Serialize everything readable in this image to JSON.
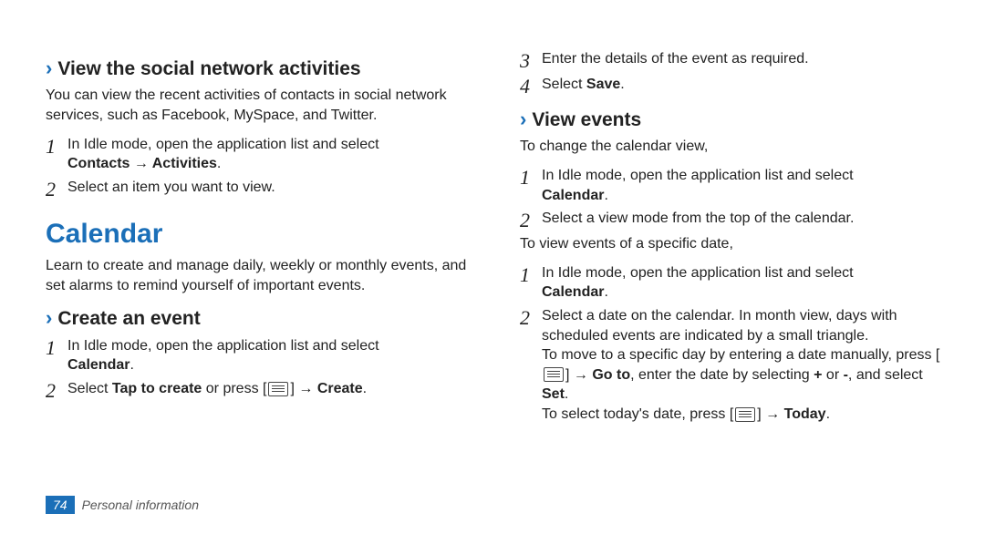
{
  "left": {
    "sub1_title": "View the social network activities",
    "sub1_para": "You can view the recent activities of contacts in social network services, such as Facebook, MySpace, and Twitter.",
    "sub1_step1_a": "In Idle mode, open the application list and select ",
    "sub1_step1_b": "Contacts → Activities",
    "sub1_step1_c": ".",
    "sub1_step2": "Select an item you want to view.",
    "section_title": "Calendar",
    "section_para": "Learn to create and manage daily, weekly or monthly events, and set alarms to remind yourself of important events.",
    "sub2_title": "Create an event",
    "sub2_step1_a": "In Idle mode, open the application list and select ",
    "sub2_step1_b": "Calendar",
    "sub2_step1_c": ".",
    "sub2_step2_a": "Select ",
    "sub2_step2_b": "Tap to create",
    "sub2_step2_c": " or press [",
    "sub2_step2_d": "] → ",
    "sub2_step2_e": "Create",
    "sub2_step2_f": "."
  },
  "right": {
    "step3": "Enter the details of the event as required.",
    "step4_a": "Select ",
    "step4_b": "Save",
    "step4_c": ".",
    "sub3_title": "View events",
    "sub3_para": "To change the calendar view,",
    "sub3_step1_a": "In Idle mode, open the application list and select ",
    "sub3_step1_b": "Calendar",
    "sub3_step1_c": ".",
    "sub3_step2": "Select a view mode from the top of the calendar.",
    "sub3_para2": "To view events of a specific date,",
    "sub3b_step1_a": "In Idle mode, open the application list and select ",
    "sub3b_step1_b": "Calendar",
    "sub3b_step1_c": ".",
    "sub3b_step2_a": "Select a date on the calendar. In month view, days with scheduled events are indicated by a small triangle.",
    "sub3b_step2_b1": "To move to a specific day by entering a date manually, press [",
    "sub3b_step2_b2": "] → ",
    "sub3b_step2_b3": "Go to",
    "sub3b_step2_b4": ", enter the date by selecting ",
    "sub3b_step2_b5": "+",
    "sub3b_step2_b6": " or ",
    "sub3b_step2_b7": "-",
    "sub3b_step2_b8": ", and select ",
    "sub3b_step2_b9": "Set",
    "sub3b_step2_b10": ".",
    "sub3b_step2_c1": "To select today's date, press [",
    "sub3b_step2_c2": "] → ",
    "sub3b_step2_c3": "Today",
    "sub3b_step2_c4": "."
  },
  "footer": {
    "page_num": "74",
    "section": "Personal information"
  },
  "nums": {
    "n1": "1",
    "n2": "2",
    "n3": "3",
    "n4": "4"
  }
}
